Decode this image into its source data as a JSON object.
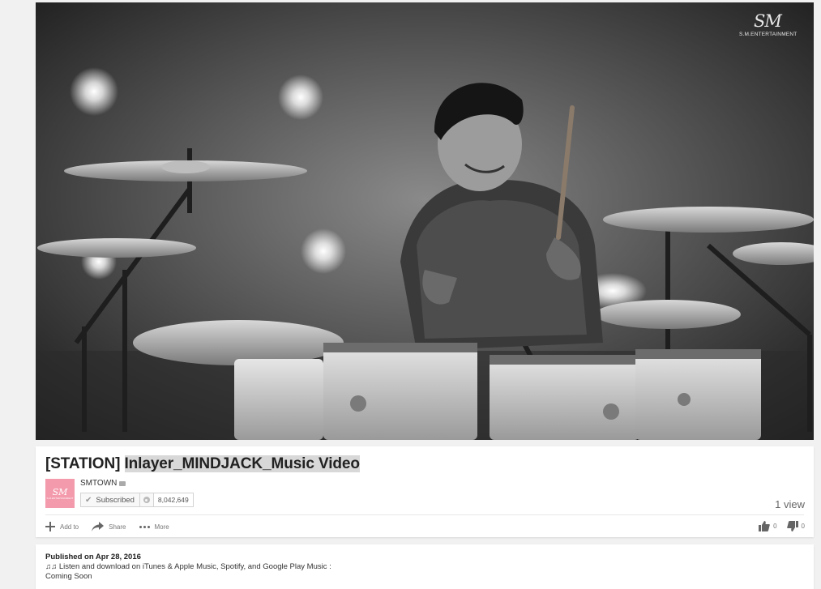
{
  "player": {
    "watermark_logo": "SM",
    "watermark_text": "S.M.ENTERTAINMENT"
  },
  "video": {
    "title_prefix": "[STATION] ",
    "title_highlight": "Inlayer_MINDJACK_Music Video",
    "views": "1 view"
  },
  "channel": {
    "avatar_logo": "SM",
    "avatar_text": "S.M.ENTERTAINMENT",
    "name": "SMTOWN",
    "subscribe_label": "Subscribed",
    "subscriber_count": "8,042,649"
  },
  "actions": {
    "add_to": "Add to",
    "share": "Share",
    "more": "More",
    "likes": "0",
    "dislikes": "0"
  },
  "description": {
    "published": "Published on Apr 28, 2016",
    "line1": "♫♫ Listen and download on iTunes & Apple Music, Spotify, and Google Play Music :",
    "line2": "Coming Soon"
  }
}
